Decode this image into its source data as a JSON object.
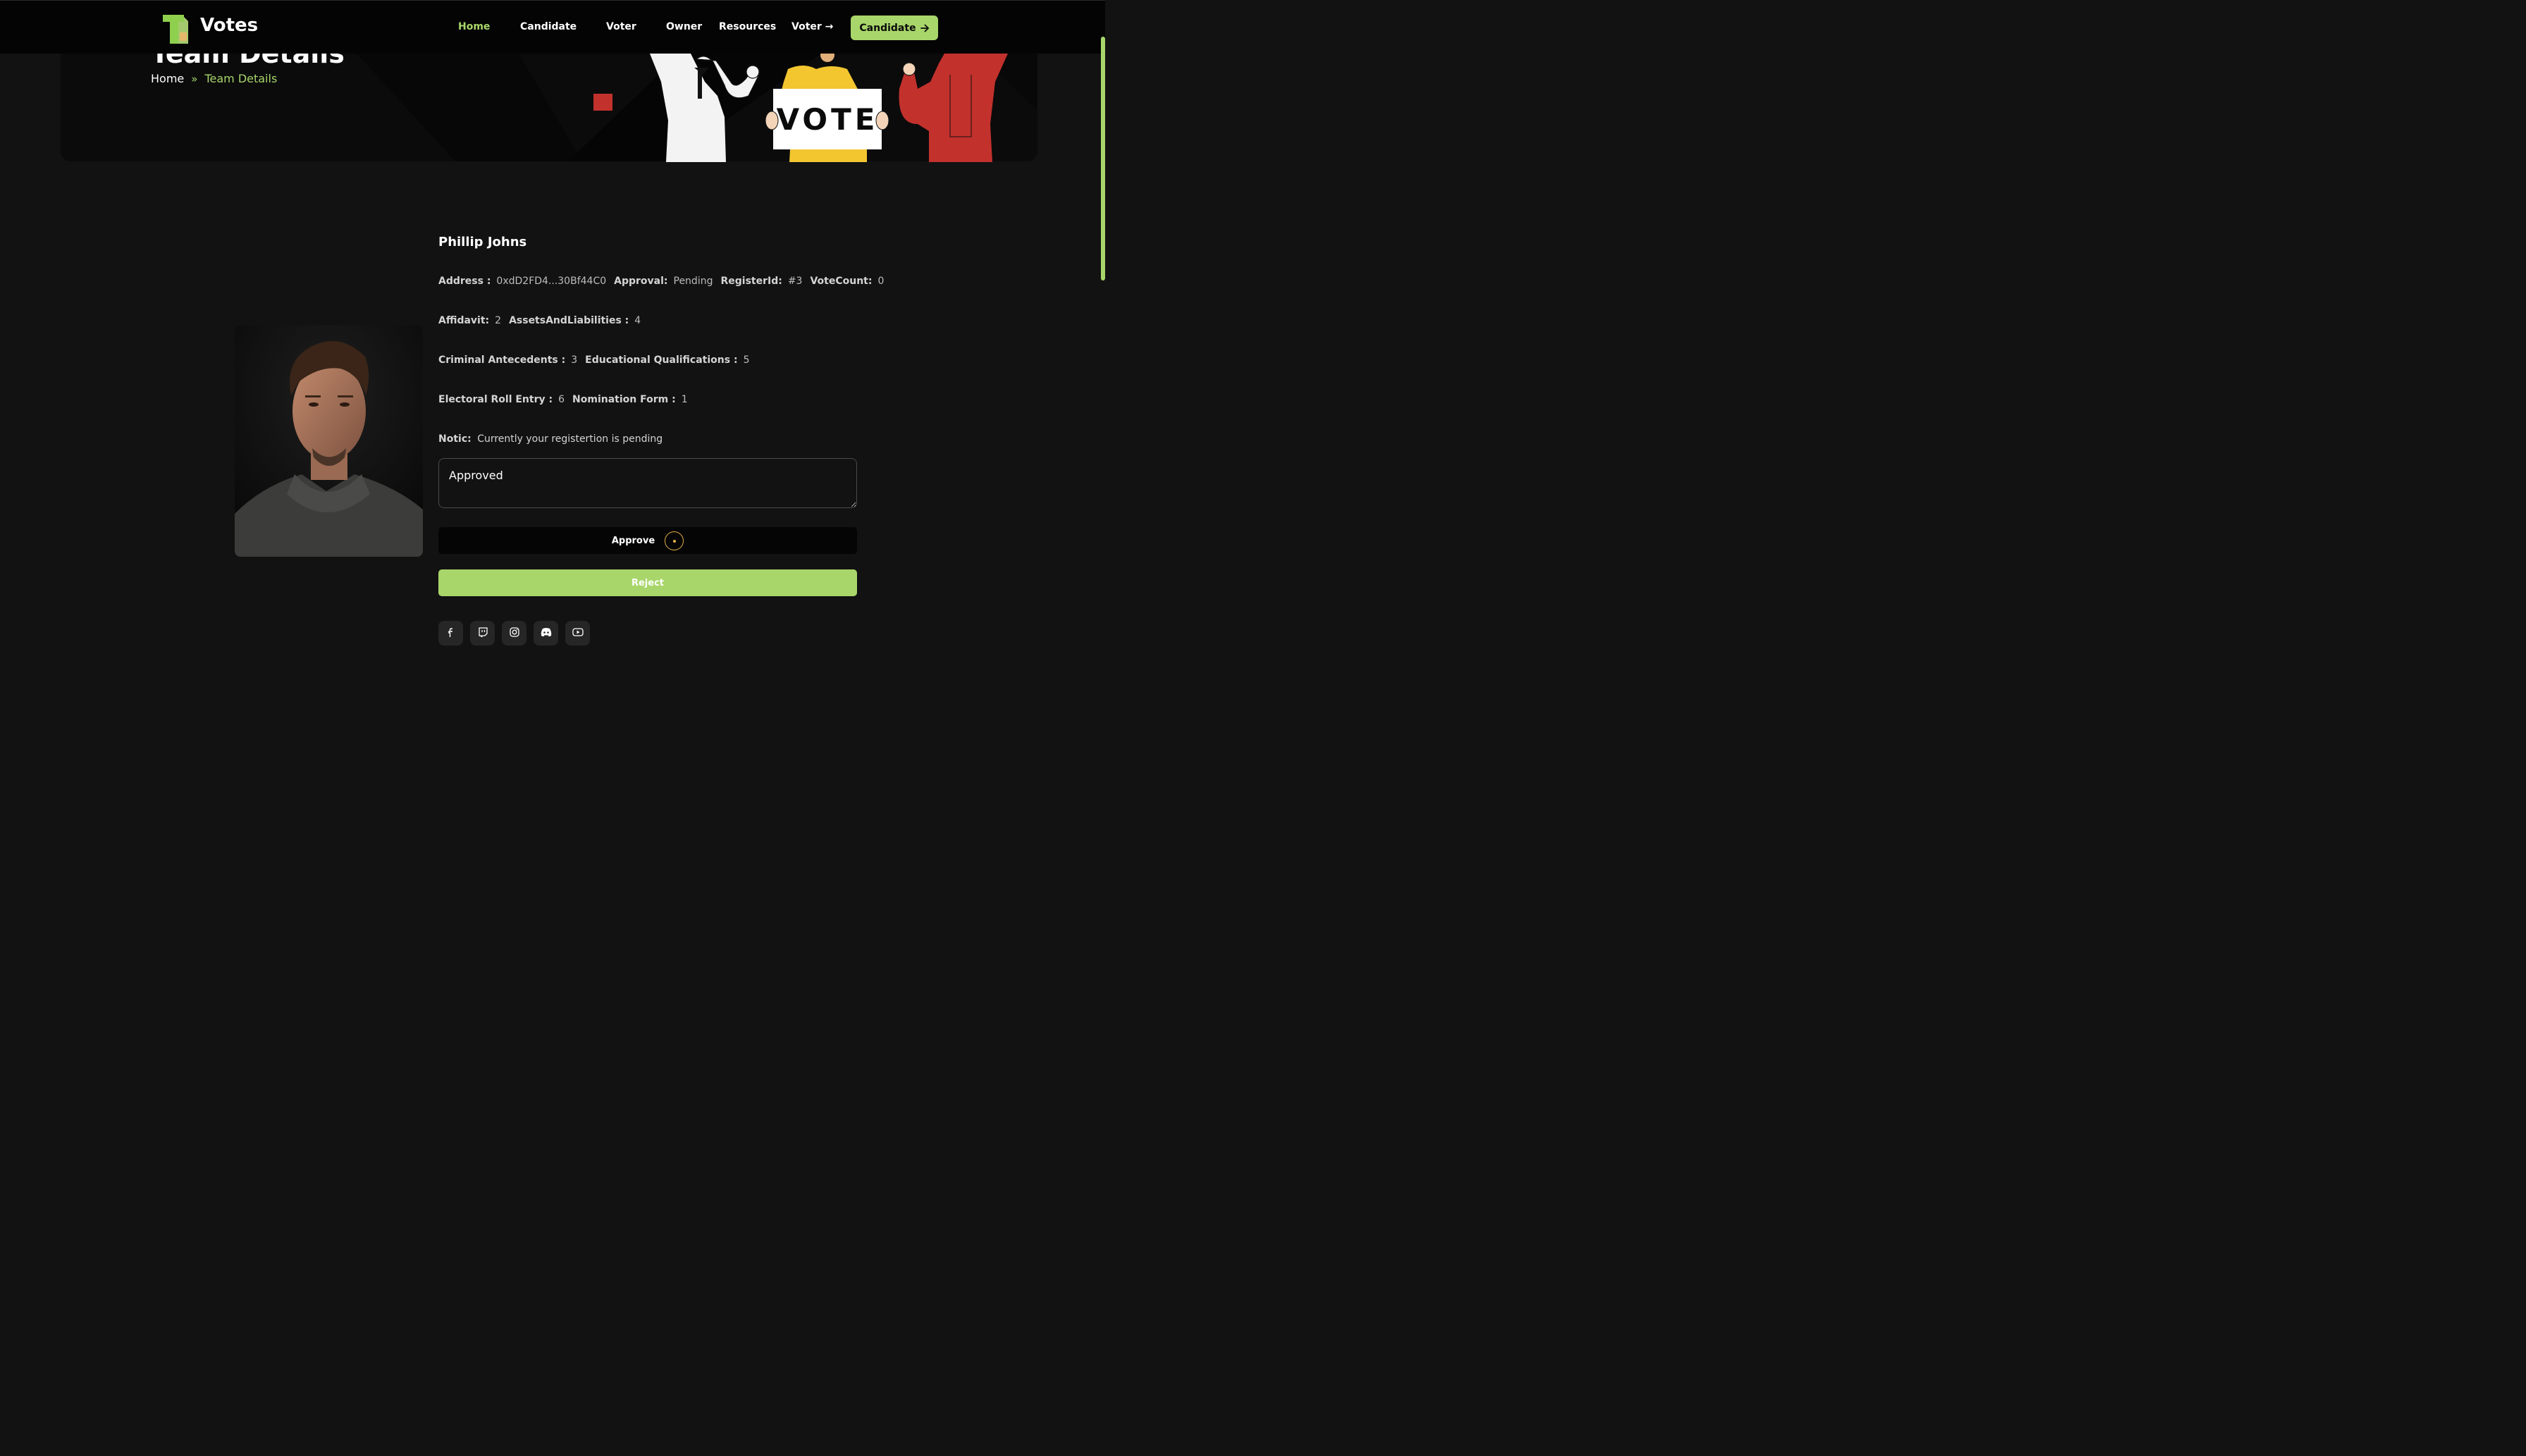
{
  "brand": {
    "name": "Votes"
  },
  "nav": {
    "items": [
      {
        "label": "Home",
        "active": true
      },
      {
        "label": "Candidate",
        "active": false
      },
      {
        "label": "Voter",
        "active": false
      },
      {
        "label": "Owner",
        "active": false
      },
      {
        "label": "Resources",
        "active": false
      },
      {
        "label": "Voter →",
        "active": false
      }
    ],
    "cta": {
      "label": "Candidate",
      "icon": "arrow-right-icon"
    }
  },
  "hero": {
    "title": "Team Details",
    "breadcrumb": {
      "home": "Home",
      "separator": "»",
      "current": "Team Details"
    },
    "illustration_sign": "VOTE"
  },
  "candidate": {
    "name": "Phillip Johns",
    "address_label": "Address :",
    "address": "0xdD2FD4...30Bf44C0",
    "approval_label": "Approval:",
    "approval": "Pending",
    "register_id_label": "RegisterId:",
    "register_id": "#3",
    "vote_count_label": "VoteCount:",
    "vote_count": "0",
    "affidavit_label": "Affidavit:",
    "affidavit": "2",
    "assets_label": "AssetsAndLiabilities :",
    "assets": "4",
    "criminal_label": "Criminal Antecedents :",
    "criminal": "3",
    "education_label": "Educational Qualifications :",
    "education": "5",
    "electoral_label": "Electoral Roll Entry :",
    "electoral": "6",
    "nomination_label": "Nomination Form :",
    "nomination": "1",
    "notice_label": "Notic:",
    "notice": "Currently your registertion is pending"
  },
  "form": {
    "message_value": "Approved",
    "approve_label": "Approve",
    "reject_label": "Reject"
  },
  "socials": [
    "facebook-icon",
    "twitch-icon",
    "instagram-icon",
    "discord-icon",
    "youtube-icon"
  ],
  "colors": {
    "accent": "#a8d66a",
    "background": "#121212",
    "navbar": "#040404",
    "spinner": "#e7b14a"
  }
}
